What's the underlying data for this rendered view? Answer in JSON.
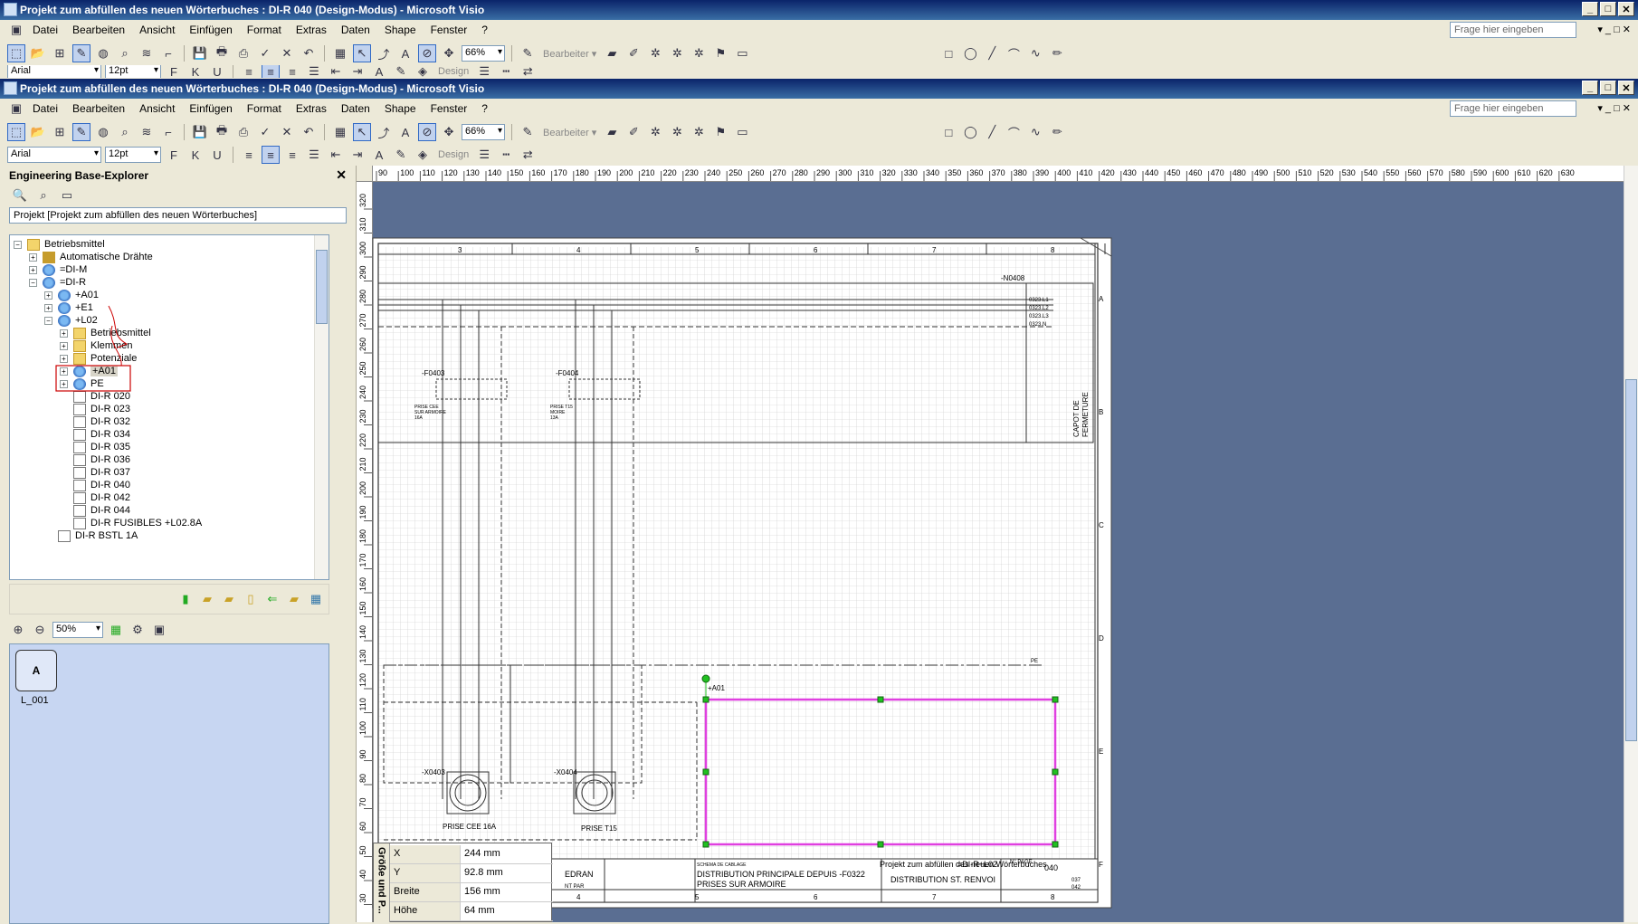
{
  "window1": {
    "title": "Projekt zum abfüllen des neuen Wörterbuches : DI-R 040 (Design-Modus) - Microsoft Visio"
  },
  "window2": {
    "title": "Projekt zum abfüllen des neuen Wörterbuches : DI-R 040 (Design-Modus) - Microsoft Visio"
  },
  "menu": {
    "items": [
      "Datei",
      "Bearbeiten",
      "Ansicht",
      "Einfügen",
      "Format",
      "Extras",
      "Daten",
      "Shape",
      "Fenster",
      "?"
    ],
    "help_placeholder": "Frage hier eingeben"
  },
  "toolbar": {
    "zoom": "66%",
    "edit_label": "Bearbeiter",
    "font": "Arial",
    "font_size": "12pt",
    "design_label": "Design",
    "bold": "F",
    "italic": "K",
    "underline": "U"
  },
  "explorer": {
    "title": "Engineering Base-Explorer",
    "project": "Projekt [Projekt zum abfüllen des neuen Wörterbuches]",
    "tree": [
      {
        "label": "Betriebsmittel",
        "indent": 0,
        "icon": "folder",
        "exp": "−"
      },
      {
        "label": "Automatische Drähte",
        "indent": 1,
        "icon": "wires",
        "exp": "+"
      },
      {
        "label": "=DI-M",
        "indent": 1,
        "icon": "globe",
        "exp": "+"
      },
      {
        "label": "=DI-R",
        "indent": 1,
        "icon": "globe",
        "exp": "−"
      },
      {
        "label": "+A01",
        "indent": 2,
        "icon": "globe",
        "exp": "+"
      },
      {
        "label": "+E1",
        "indent": 2,
        "icon": "globe",
        "exp": "+"
      },
      {
        "label": "+L02",
        "indent": 2,
        "icon": "globe",
        "exp": "−"
      },
      {
        "label": "Betriebsmittel",
        "indent": 3,
        "icon": "folder",
        "exp": "+"
      },
      {
        "label": "Klemmen",
        "indent": 3,
        "icon": "folder",
        "exp": "+"
      },
      {
        "label": "Potenziale",
        "indent": 3,
        "icon": "folder",
        "exp": "+"
      },
      {
        "label": "+A01",
        "indent": 3,
        "icon": "globe",
        "exp": "+",
        "selected": true
      },
      {
        "label": "PE",
        "indent": 3,
        "icon": "globe",
        "exp": "+"
      },
      {
        "label": "DI-R 020",
        "indent": 3,
        "icon": "page",
        "exp": ""
      },
      {
        "label": "DI-R 023",
        "indent": 3,
        "icon": "page",
        "exp": ""
      },
      {
        "label": "DI-R 032",
        "indent": 3,
        "icon": "page",
        "exp": ""
      },
      {
        "label": "DI-R 034",
        "indent": 3,
        "icon": "page",
        "exp": ""
      },
      {
        "label": "DI-R 035",
        "indent": 3,
        "icon": "page",
        "exp": ""
      },
      {
        "label": "DI-R 036",
        "indent": 3,
        "icon": "page",
        "exp": ""
      },
      {
        "label": "DI-R 037",
        "indent": 3,
        "icon": "page",
        "exp": ""
      },
      {
        "label": "DI-R 040",
        "indent": 3,
        "icon": "page",
        "exp": ""
      },
      {
        "label": "DI-R 042",
        "indent": 3,
        "icon": "page",
        "exp": ""
      },
      {
        "label": "DI-R 044",
        "indent": 3,
        "icon": "page",
        "exp": ""
      },
      {
        "label": "DI-R FUSIBLES +L02.8A",
        "indent": 3,
        "icon": "page",
        "exp": ""
      },
      {
        "label": "DI-R BSTL 1A",
        "indent": 2,
        "icon": "page",
        "exp": ""
      }
    ],
    "zoom": "50%",
    "stencil_item": "L_001",
    "stencil_glyph": "A"
  },
  "ruler": {
    "h_ticks": [
      "90",
      "100",
      "110",
      "120",
      "130",
      "140",
      "150",
      "160",
      "170",
      "180",
      "190",
      "200",
      "210",
      "220",
      "230",
      "240",
      "250",
      "260",
      "270",
      "280",
      "290",
      "300",
      "310",
      "320",
      "330",
      "340",
      "350",
      "360",
      "370",
      "380",
      "390",
      "400",
      "410",
      "420",
      "430",
      "440",
      "450",
      "460",
      "470",
      "480",
      "490",
      "500",
      "510",
      "520",
      "530",
      "540",
      "550",
      "560",
      "570",
      "580",
      "590",
      "600",
      "610",
      "620",
      "630"
    ],
    "v_ticks": [
      "320",
      "310",
      "300",
      "290",
      "280",
      "270",
      "260",
      "250",
      "240",
      "230",
      "220",
      "210",
      "200",
      "190",
      "180",
      "170",
      "160",
      "150",
      "140",
      "130",
      "120",
      "110",
      "100",
      "90",
      "80",
      "70",
      "60",
      "50",
      "40",
      "30"
    ]
  },
  "drawing": {
    "col_numbers": [
      "3",
      "4",
      "5",
      "6",
      "7",
      "8"
    ],
    "row_letters": [
      "A",
      "B",
      "C",
      "D",
      "E",
      "F"
    ],
    "n_label": "-N0408",
    "terminal_labels": [
      "0323.L1",
      "0323.L2",
      "0323.L3",
      "0323.N"
    ],
    "f1_label": "-F0403",
    "f1_desc": [
      "PRISE CEE",
      "SUR ARMOIRE",
      "16A"
    ],
    "f2_label": "-F0404",
    "f2_desc": [
      "PRISE T15",
      "MOIRE",
      "13A"
    ],
    "capot": [
      "CAPOT DE",
      "FERMETURE"
    ],
    "pe_label": "PE",
    "a01_label": "+A01",
    "x1_label": "-X0403",
    "x2_label": "-X0404",
    "socket1": "PRISE CEE 16A",
    "socket2": "PRISE T15",
    "tb_schema": "SCHEMA DE CABLAGE",
    "tb_title1": "DISTRIBUTION PRINCIPALE DEPUIS -F0322",
    "tb_title2": "PRISES SUR ARMOIRE",
    "tb_project": "Projekt zum abfüllen des neuen Wörterbuches",
    "tb_ref": "=DI-R+L02",
    "tb_dist": "DISTRIBUTION ST. RENVOI",
    "tb_page_label": "N° PAGE",
    "tb_page": "040",
    "tb_sub1": "037",
    "tb_sub2": "042",
    "tb_edran": "EDRAN",
    "tb_par": "NT PAR"
  },
  "size_position": {
    "title": "Größe und P...",
    "rows": [
      {
        "key": "X",
        "value": "244 mm"
      },
      {
        "key": "Y",
        "value": "92.8 mm"
      },
      {
        "key": "Breite",
        "value": "156 mm"
      },
      {
        "key": "Höhe",
        "value": "64 mm"
      }
    ]
  },
  "colors": {
    "selection": "#e040e0",
    "handle": "#20c020",
    "canvas_bg": "#5a6e92",
    "stencil_bg": "#c7d6f2",
    "annotation": "#cc0000"
  }
}
